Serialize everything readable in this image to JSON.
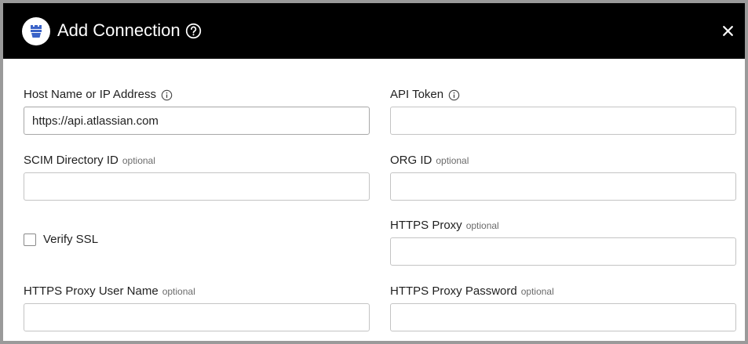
{
  "dialog": {
    "title": "Add Connection",
    "close_icon": "close-icon",
    "help_icon": "help-circle-icon",
    "logo_icon": "castle-tower-icon",
    "colors": {
      "header_bg": "#000000",
      "header_text": "#ffffff",
      "frame_border": "#9a9a9a",
      "input_border": "#c4c4c4"
    }
  },
  "form": {
    "host": {
      "label": "Host Name or IP Address",
      "value": "https://api.atlassian.com",
      "info_icon": "info-icon"
    },
    "api_token": {
      "label": "API Token",
      "value": "",
      "info_icon": "info-icon"
    },
    "scim_directory_id": {
      "label": "SCIM Directory ID",
      "optional": "optional",
      "value": ""
    },
    "org_id": {
      "label": "ORG ID",
      "optional": "optional",
      "value": ""
    },
    "verify_ssl": {
      "label": "Verify SSL",
      "checked": false
    },
    "https_proxy": {
      "label": "HTTPS Proxy",
      "optional": "optional",
      "value": ""
    },
    "https_proxy_user_name": {
      "label": "HTTPS Proxy User Name",
      "optional": "optional",
      "value": ""
    },
    "https_proxy_password": {
      "label": "HTTPS Proxy Password",
      "optional": "optional",
      "value": ""
    }
  }
}
